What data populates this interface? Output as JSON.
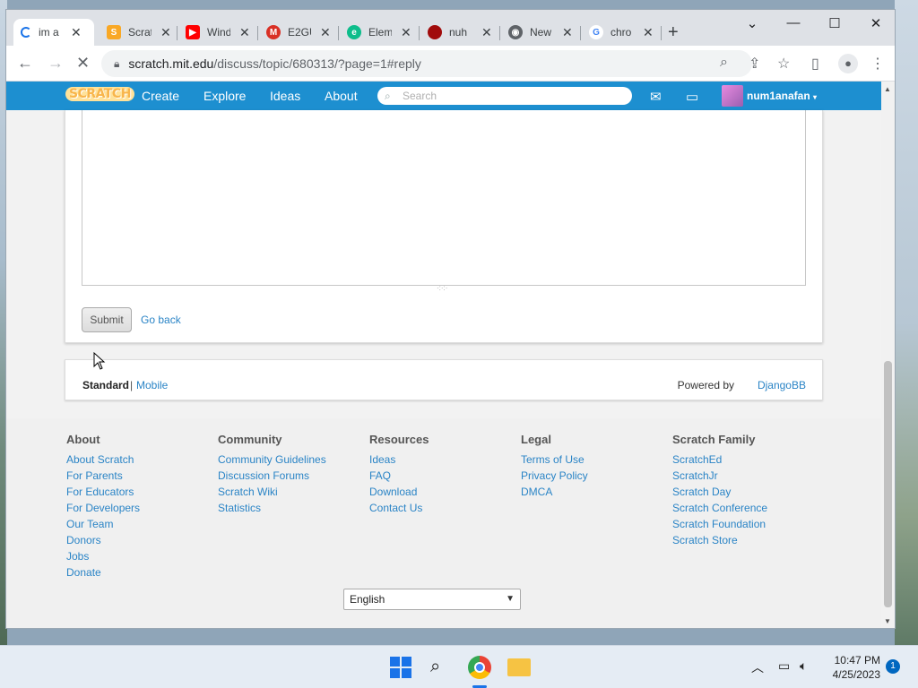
{
  "browser": {
    "tabs": [
      {
        "title": "im a",
        "favicon": "loading-spinner",
        "active": true
      },
      {
        "title": "Scrat",
        "favicon": "scratch-icon"
      },
      {
        "title": "Wind",
        "favicon": "youtube-icon"
      },
      {
        "title": "E2GU",
        "favicon": "gmail-icon"
      },
      {
        "title": "Elem",
        "favicon": "element-icon"
      },
      {
        "title": "nuh",
        "favicon": "red-circle-icon"
      },
      {
        "title": "New",
        "favicon": "chrome-icon"
      },
      {
        "title": "chro",
        "favicon": "google-icon"
      }
    ],
    "url_host": "scratch.mit.edu",
    "url_path": "/discuss/topic/680313/?page=1#reply"
  },
  "scratch_nav": {
    "logo": "SCRATCH",
    "links": [
      "Create",
      "Explore",
      "Ideas",
      "About"
    ],
    "search_placeholder": "Search",
    "username": "num1anafan"
  },
  "post_form": {
    "submit_label": "Submit",
    "go_back_label": "Go back"
  },
  "footer_bar": {
    "standard": "Standard",
    "separator": "|",
    "mobile": "Mobile",
    "powered_by": "Powered by",
    "engine": "DjangoBB"
  },
  "footer": {
    "columns": [
      {
        "heading": "About",
        "links": [
          "About Scratch",
          "For Parents",
          "For Educators",
          "For Developers",
          "Our Team",
          "Donors",
          "Jobs",
          "Donate"
        ]
      },
      {
        "heading": "Community",
        "links": [
          "Community Guidelines",
          "Discussion Forums",
          "Scratch Wiki",
          "Statistics"
        ]
      },
      {
        "heading": "Resources",
        "links": [
          "Ideas",
          "FAQ",
          "Download",
          "Contact Us"
        ]
      },
      {
        "heading": "Legal",
        "links": [
          "Terms of Use",
          "Privacy Policy",
          "DMCA"
        ]
      },
      {
        "heading": "Scratch Family",
        "links": [
          "ScratchEd",
          "ScratchJr",
          "Scratch Day",
          "Scratch Conference",
          "Scratch Foundation",
          "Scratch Store"
        ]
      }
    ],
    "language": "English"
  },
  "taskbar": {
    "time": "10:47 PM",
    "date": "4/25/2023",
    "notification_count": "1"
  },
  "colors": {
    "scratch_blue": "#1d8fd0",
    "link_blue": "#2a84c6"
  }
}
